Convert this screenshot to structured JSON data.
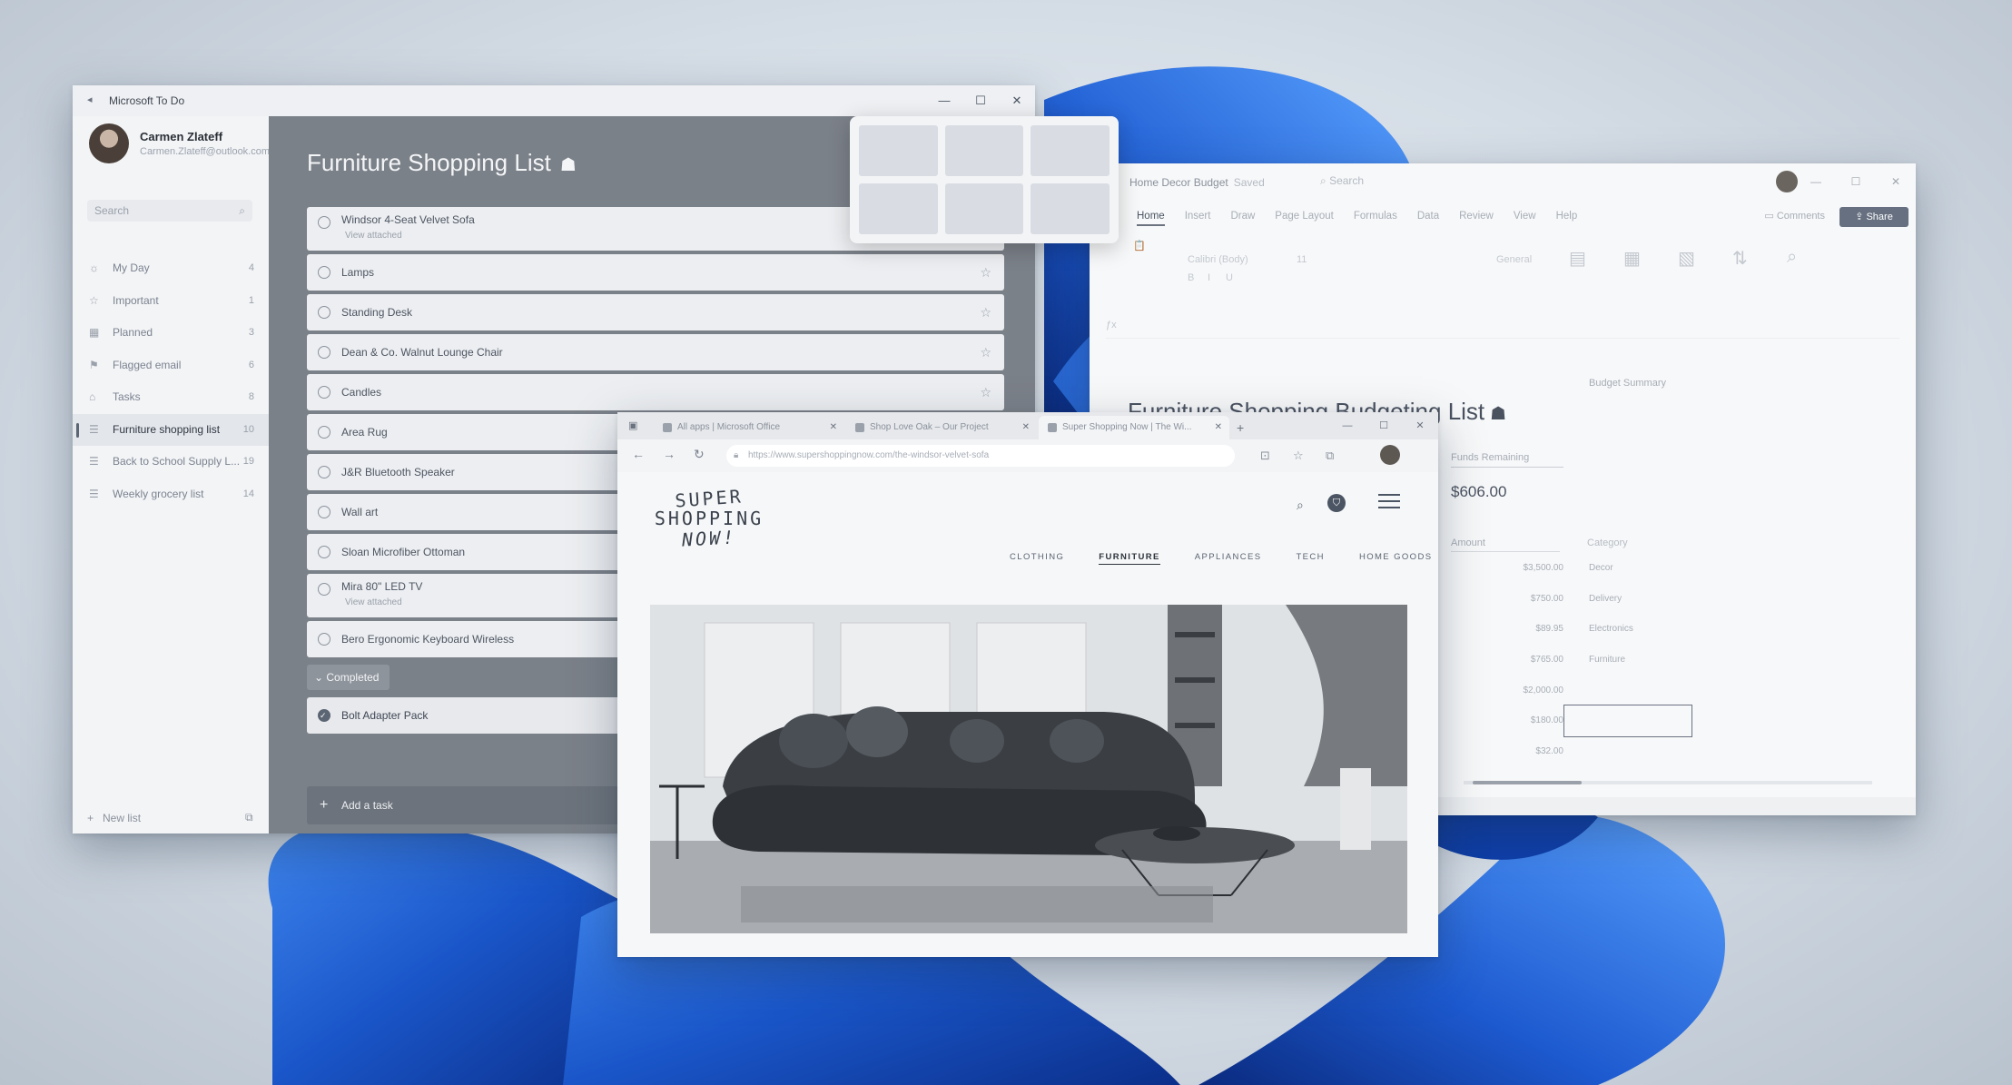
{
  "colors": {
    "wallpaper_blue": "#1a56c9",
    "todo_accent": "#7b8189",
    "excel_share": "#667080"
  },
  "todo": {
    "window_title": "Microsoft To Do",
    "user": {
      "name": "Carmen Zlateff",
      "email": "Carmen.Zlateff@outlook.com"
    },
    "search_placeholder": "Search",
    "nav": [
      {
        "label": "My Day",
        "count": "4",
        "icon": "sun-icon"
      },
      {
        "label": "Important",
        "count": "1",
        "icon": "star-icon"
      },
      {
        "label": "Planned",
        "count": "3",
        "icon": "calendar-icon"
      },
      {
        "label": "Flagged email",
        "count": "6",
        "icon": "flag-icon"
      },
      {
        "label": "Tasks",
        "count": "8",
        "icon": "home-icon"
      },
      {
        "label": "Furniture shopping list",
        "count": "10",
        "icon": "list-icon"
      },
      {
        "label": "Back to School Supply L...",
        "count": "19",
        "icon": "list-icon"
      },
      {
        "label": "Weekly grocery list",
        "count": "14",
        "icon": "list-icon"
      }
    ],
    "new_list_label": "New list",
    "list_title": "Furniture Shopping List",
    "tasks": [
      {
        "title": "Windsor 4-Seat Velvet Sofa",
        "sub": "View attached"
      },
      {
        "title": "Lamps"
      },
      {
        "title": "Standing Desk"
      },
      {
        "title": "Dean & Co. Walnut Lounge Chair"
      },
      {
        "title": "Candles"
      },
      {
        "title": "Area Rug"
      },
      {
        "title": "J&R Bluetooth Speaker"
      },
      {
        "title": "Wall art"
      },
      {
        "title": "Sloan Microfiber Ottoman"
      },
      {
        "title": "Mira 80\" LED TV",
        "sub": "View attached"
      },
      {
        "title": "Bero Ergonomic Keyboard Wireless"
      }
    ],
    "completed_label": "Completed",
    "completed_tasks": [
      {
        "title": "Bolt Adapter Pack"
      }
    ],
    "add_task_label": "Add a task"
  },
  "excel": {
    "doc_title": "Home Decor Budget",
    "doc_status": "Saved",
    "search_placeholder": "Search",
    "tabs": [
      "Home",
      "Insert",
      "Draw",
      "Page Layout",
      "Formulas",
      "Data",
      "Review",
      "View",
      "Help"
    ],
    "comments_label": "Comments",
    "share_label": "Share",
    "font_name": "Calibri (Body)",
    "font_size": "11",
    "number_format": "General",
    "heading": "Furniture Shopping Budgeting List",
    "budget_summary_label": "Budget Summary",
    "funds_label": "Funds Remaining",
    "funds_value": "$606.00",
    "amount_label": "Amount",
    "category_label": "Category",
    "amounts": [
      "$3,500.00",
      "$750.00",
      "$89.95",
      "$765.00",
      "$2,000.00",
      "$180.00",
      "$32.00"
    ],
    "categories": [
      "Decor",
      "Delivery",
      "Electronics",
      "Furniture"
    ]
  },
  "browser": {
    "tabs": [
      {
        "label": "All apps | Microsoft Office"
      },
      {
        "label": "Shop Love Oak – Our Project"
      },
      {
        "label": "Super Shopping Now | The Wi..."
      }
    ],
    "url": "https://www.supershoppingnow.com/the-windsor-velvet-sofa",
    "logo": {
      "line1": "SUPER",
      "line2": "SHOPPING",
      "line3": "NOW!"
    },
    "site_nav": [
      "CLOTHING",
      "FURNITURE",
      "APPLIANCES",
      "TECH",
      "HOME GOODS"
    ]
  }
}
